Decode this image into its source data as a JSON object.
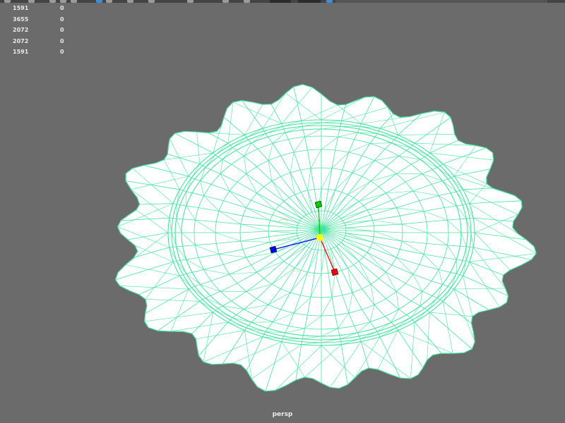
{
  "app": "Maya viewport",
  "hud": {
    "rows": [
      {
        "value": "1591",
        "selected": "0"
      },
      {
        "value": "3655",
        "selected": "0"
      },
      {
        "value": "2072",
        "selected": "0"
      },
      {
        "value": "2072",
        "selected": "0"
      },
      {
        "value": "1591",
        "selected": "0"
      }
    ]
  },
  "viewport": {
    "camera": "persp",
    "background": "#6b6b6b",
    "wire_color": "#45e3a0",
    "surface_color": "#ffffff"
  },
  "manipulator": {
    "x_axis_color": "#ff0000",
    "y_axis_color": "#00cc00",
    "z_axis_color": "#0000ff",
    "center_color": "#ffff00"
  },
  "toolbar": {
    "icons": [
      "select-tool",
      "lasso-tool",
      "paint-tool",
      "move-tool",
      "rotate-tool",
      "scale-tool",
      "snap-grid",
      "snap-curve",
      "snap-point",
      "snap-view",
      "render",
      "ipr-render",
      "render-settings",
      "display-settings"
    ]
  }
}
